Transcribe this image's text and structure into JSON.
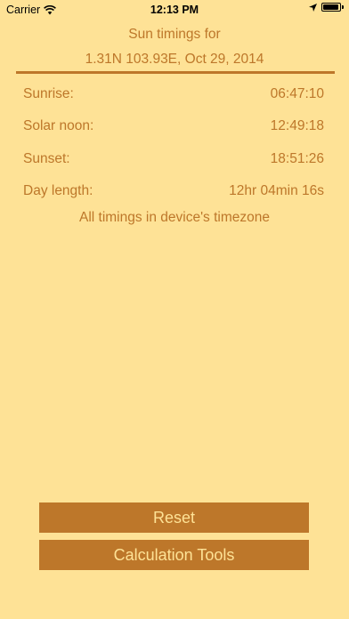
{
  "status_bar": {
    "carrier": "Carrier",
    "time": "12:13 PM",
    "battery_level": 0.95
  },
  "header": {
    "line1": "Sun timings for",
    "line2": "1.31N 103.93E, Oct 29, 2014"
  },
  "timings": [
    {
      "label": "Sunrise:",
      "value": "06:47:10"
    },
    {
      "label": "Solar noon:",
      "value": "12:49:18"
    },
    {
      "label": "Sunset:",
      "value": "18:51:26"
    },
    {
      "label": "Day length:",
      "value": "12hr 04min 16s"
    }
  ],
  "footnote": "All timings in device's timezone",
  "buttons": {
    "reset": "Reset",
    "calculation_tools": "Calculation Tools"
  },
  "colors": {
    "background": "#FEE296",
    "accent": "#BD772A"
  }
}
